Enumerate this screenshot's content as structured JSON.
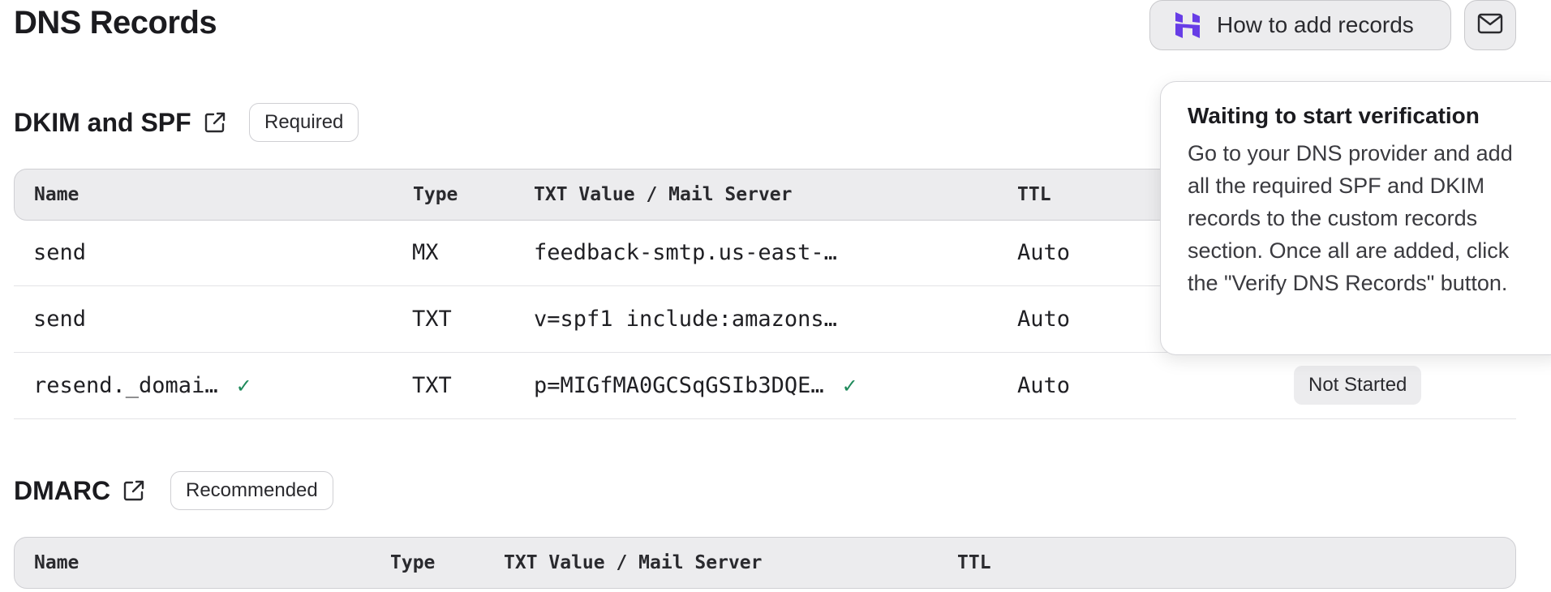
{
  "page": {
    "title": "DNS Records"
  },
  "header": {
    "how_to_label": "How to add records",
    "how_to_icon": "hostinger-logo-icon",
    "mail_icon": "mail-icon"
  },
  "sections": [
    {
      "title": "DKIM and SPF",
      "badge": "Required",
      "columns": [
        "Name",
        "Type",
        "TXT Value / Mail Server",
        "TTL"
      ],
      "rows": [
        {
          "name": "send",
          "type": "MX",
          "value": "feedback-smtp.us-east-…",
          "ttl": "Auto"
        },
        {
          "name": "send",
          "type": "TXT",
          "value": "v=spf1 include:amazons…",
          "ttl": "Auto"
        },
        {
          "name": "resend._domai…",
          "name_verified": true,
          "type": "TXT",
          "value": "p=MIGfMA0GCSqGSIb3DQE…",
          "value_verified": true,
          "ttl": "Auto",
          "status": "Not Started"
        }
      ]
    },
    {
      "title": "DMARC",
      "badge": "Recommended",
      "columns": [
        "Name",
        "Type",
        "TXT Value / Mail Server",
        "TTL"
      ]
    }
  ],
  "tooltip": {
    "title": "Waiting to start verification",
    "body": "Go to your DNS provider and add all the required SPF and DKIM records to the custom records section. Once all are added, click the \"Verify DNS Records\" button."
  },
  "colors": {
    "accent_icon": "#673de6",
    "check": "#1f8a5b",
    "header_bg": "#ececee"
  }
}
